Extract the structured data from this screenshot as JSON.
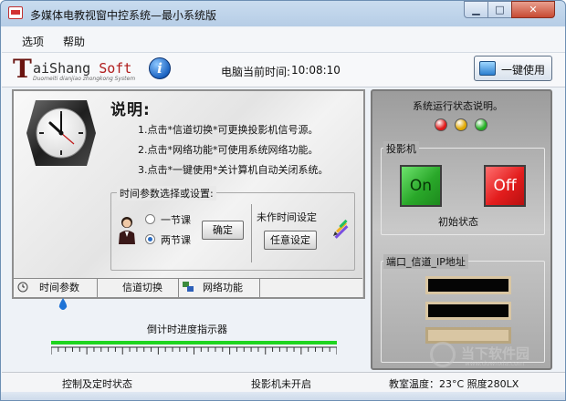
{
  "window": {
    "title": "多媒体电教视窗中控系统—最小系统版",
    "min_glyph": "▁",
    "max_glyph": "□",
    "close_glyph": "✕"
  },
  "menu": {
    "items": [
      "选项",
      "帮助"
    ]
  },
  "header": {
    "logo_letter": "T",
    "logo_name_main": "aiShang",
    "logo_name_accent": "Soft",
    "logo_sub": "Duomeiti dianjiao zhongkong System",
    "info_glyph": "i",
    "clock_label": "电脑当前时间:",
    "clock_value": "10:08:10",
    "onekey_label": "一键使用"
  },
  "explain": {
    "title": "说明:",
    "lines": [
      "1.点击*信道切换*可更换投影机信号源。",
      "2.点击*网络功能*可使用系统网络功能。",
      "3.点击*一键使用*关计算机自动关闭系统。"
    ]
  },
  "time_params": {
    "group_title": "时间参数选择或设置:",
    "options": [
      "一节课",
      "两节课"
    ],
    "selected_index": 1,
    "confirm_label": "确定",
    "unset_label": "未作时间设定",
    "free_label": "任意设定"
  },
  "tabs": [
    "时间参数",
    "信道切换",
    "网络功能"
  ],
  "progress": {
    "label": "倒计时进度指示器",
    "fraction": 1.0
  },
  "status_panel": {
    "title": "系统运行状态说明。",
    "lights": [
      "#e01818",
      "#e0a800",
      "#22b022"
    ],
    "projector_title": "投影机",
    "on_label": "On",
    "off_label": "Off",
    "initial_label": "初始状态",
    "port_title": "端口_信道_IP地址"
  },
  "watermark": {
    "text": "当下软件园",
    "url": "www.downxia.com"
  },
  "statusbar": {
    "control_label": "控制及定时状态",
    "projector_status": "投影机未开启",
    "env_info": "教室温度：23°C   照度280LX"
  },
  "colors": {
    "progress_fill": "#1fd51f",
    "on_button": "#2aa82a",
    "off_button": "#e31d1d"
  }
}
